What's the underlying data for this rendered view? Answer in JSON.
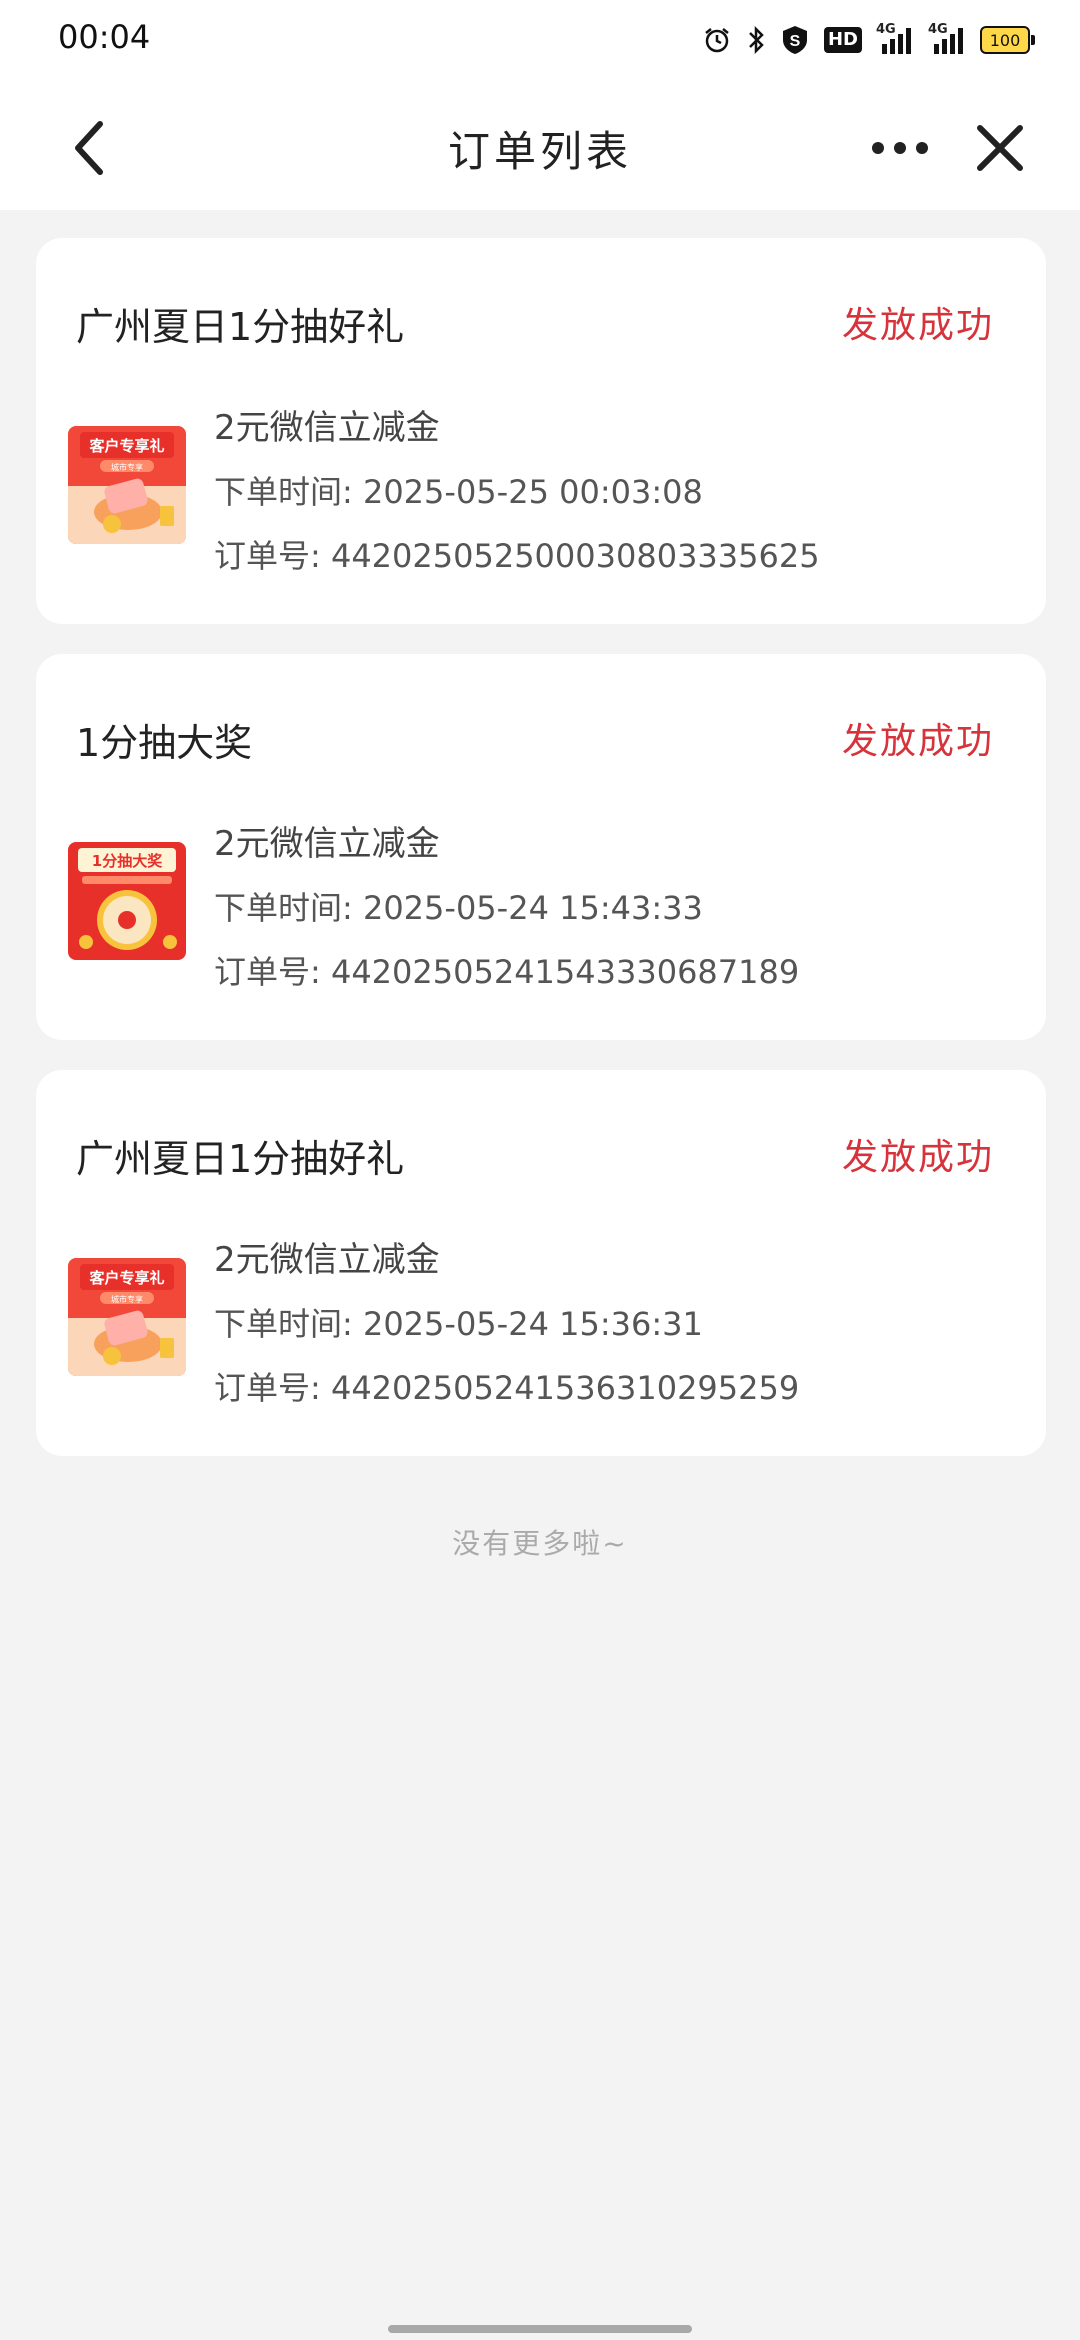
{
  "status_bar": {
    "time": "00:04",
    "icons": [
      "alarm-icon",
      "bluetooth-icon",
      "s-shield-icon",
      "hd-icon",
      "signal-4g-icon",
      "signal-4g-icon",
      "battery-icon"
    ],
    "network_label_1": "4G",
    "network_label_2": "4G",
    "hd_label": "HD",
    "battery": "100"
  },
  "nav": {
    "title": "订单列表"
  },
  "orders": [
    {
      "title": "广州夏日1分抽好礼",
      "status": "发放成功",
      "product": "2元微信立减金",
      "order_time": "下单时间: 2025-05-25 00:03:08",
      "order_no": "订单号: 442025052500030803335625",
      "thumb_heading": "客户专享礼",
      "thumb_sub": "城市专享"
    },
    {
      "title": "1分抽大奖",
      "status": "发放成功",
      "product": "2元微信立减金",
      "order_time": "下单时间: 2025-05-24 15:43:33",
      "order_no": "订单号: 44202505241543330687189",
      "thumb_heading": "1分抽大奖",
      "thumb_sub": ""
    },
    {
      "title": "广州夏日1分抽好礼",
      "status": "发放成功",
      "product": "2元微信立减金",
      "order_time": "下单时间: 2025-05-24 15:36:31",
      "order_no": "订单号: 44202505241536310295259",
      "thumb_heading": "客户专享礼",
      "thumb_sub": "城市专享"
    }
  ],
  "footer": {
    "end_text": "没有更多啦~"
  },
  "colors": {
    "status_red": "#d6333a",
    "background": "#f3f3f3"
  }
}
